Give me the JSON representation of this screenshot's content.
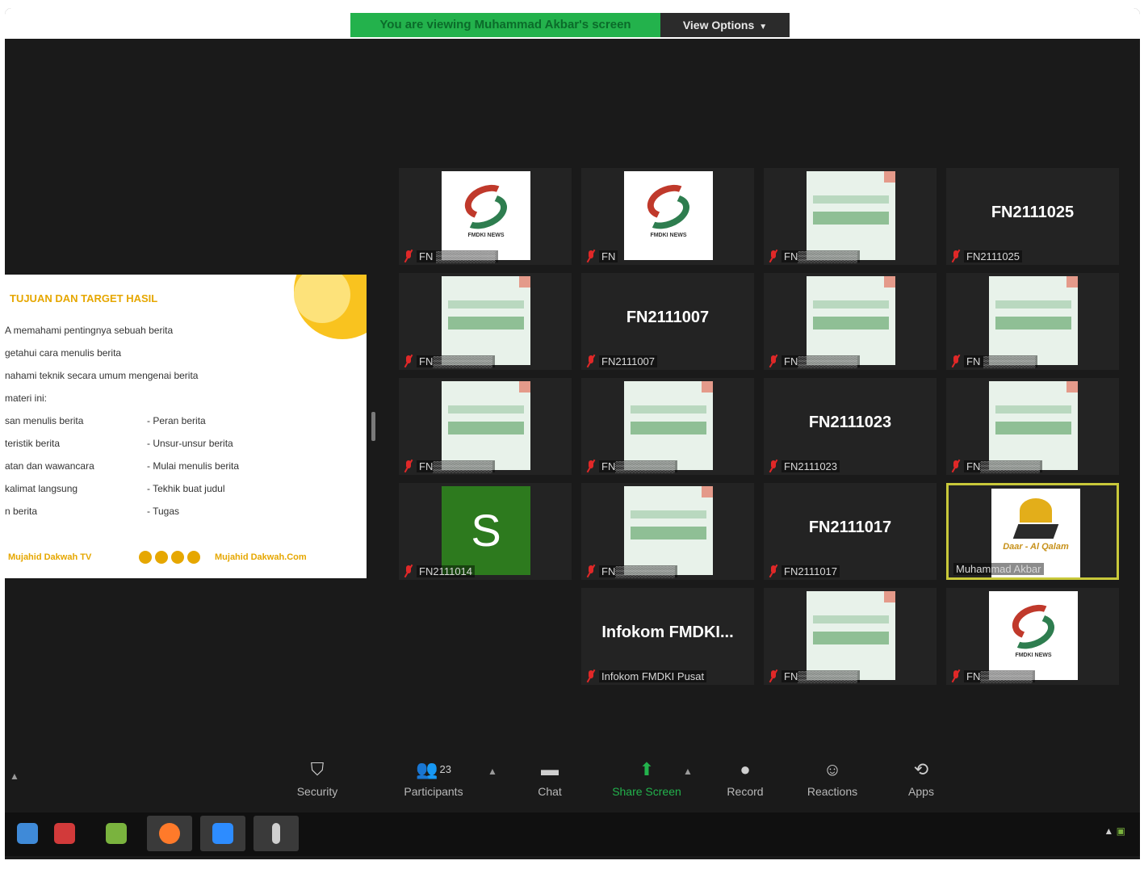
{
  "banner": {
    "text": "You are viewing Muhammad Akbar's screen",
    "color": "#23b24c"
  },
  "view_options": {
    "label": "View Options"
  },
  "slide": {
    "title": "TUJUAN DAN TARGET HASIL",
    "lines": [
      "A memahami pentingnya sebuah berita",
      "getahui cara menulis berita",
      "nahami teknik secara umum mengenai berita",
      "materi ini:"
    ],
    "left_items": [
      "san menulis berita",
      "teristik berita",
      "atan dan wawancara",
      "kalimat langsung",
      "n berita"
    ],
    "right_items": [
      "- Peran berita",
      "- Unsur-unsur berita",
      "- Mulai menulis berita",
      "- Tekhik buat judul",
      "- Tugas"
    ],
    "footer_left": "Mujahid Dakwah TV",
    "footer_right": "Mujahid Dakwah.Com"
  },
  "tiles": [
    {
      "kind": "logo-fn",
      "label": "FN ▒▒▒▒▒▒▒▒"
    },
    {
      "kind": "logo-fn",
      "label": "FN"
    },
    {
      "kind": "logo-green",
      "label": "FN▒▒▒▒▒▒▒▒"
    },
    {
      "kind": "name",
      "big": "FN2111025",
      "label": "FN2111025"
    },
    {
      "kind": "logo-green",
      "label": "FN▒▒▒▒▒▒▒▒"
    },
    {
      "kind": "name",
      "big": "FN2111007",
      "label": "FN2111007"
    },
    {
      "kind": "logo-green",
      "label": "FN▒▒▒▒▒▒▒▒"
    },
    {
      "kind": "logo-green",
      "label": "FN ▒▒▒▒▒▒▒"
    },
    {
      "kind": "logo-green",
      "label": "FN▒▒▒▒▒▒▒▒"
    },
    {
      "kind": "logo-green",
      "label": "FN▒▒▒▒▒▒▒▒"
    },
    {
      "kind": "name",
      "big": "FN2111023",
      "label": "FN2111023"
    },
    {
      "kind": "logo-green",
      "label": "FN▒▒▒▒▒▒▒▒"
    },
    {
      "kind": "letter",
      "letter": "S",
      "label": "FN2111014"
    },
    {
      "kind": "logo-green",
      "label": "FN▒▒▒▒▒▒▒▒"
    },
    {
      "kind": "name",
      "big": "FN2111017",
      "label": "FN2111017"
    },
    {
      "kind": "logo-daar",
      "script": "Daar - Al Qalam",
      "label": "Muhammad Akbar",
      "active": true
    },
    {
      "kind": "name",
      "big": "Infokom FMDKI...",
      "label": "Infokom FMDKI Pusat"
    },
    {
      "kind": "logo-green",
      "label": "FN▒▒▒▒▒▒▒▒"
    },
    {
      "kind": "logo-fn",
      "label": "FN▒▒▒▒▒▒▒"
    }
  ],
  "fn_logo_text": "FMDKI NEWS",
  "toolbar": {
    "security": "Security",
    "participants": "Participants",
    "participants_count": "23",
    "chat": "Chat",
    "share_screen": "Share Screen",
    "record": "Record",
    "reactions": "Reactions",
    "apps": "Apps"
  },
  "colors": {
    "active_border": "#c8c83a",
    "muted_red": "#e02828",
    "accent_green": "#23b24c"
  },
  "taskbar": {
    "icons": [
      "file-explorer-icon",
      "app-red-icon",
      "app-green-icon",
      "firefox-icon",
      "zoom-icon",
      "mic-app-icon"
    ],
    "tray": "▲"
  }
}
